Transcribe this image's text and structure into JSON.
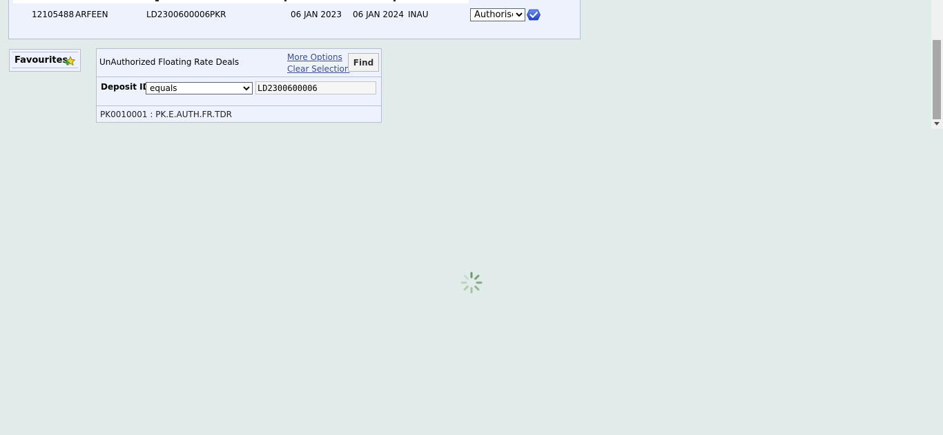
{
  "results": {
    "row": {
      "customer": "12105488",
      "name": "ARFEEN",
      "deal_id": "LD2300600006",
      "currency": "PKR",
      "value_date": "06 JAN 2023",
      "maturity_date": "06 JAN 2024",
      "status": "INAU",
      "action": {
        "selected": "Authorise",
        "options": [
          "Authorise"
        ]
      }
    },
    "go_icon": "check-go-icon"
  },
  "favourites": {
    "label": "Favourites",
    "icon": "add-star-icon"
  },
  "enquiry": {
    "title": "UnAuthorized Floating Rate Deals",
    "more_options": "More Options",
    "clear_selection": "Clear Selection",
    "find_label": "Find",
    "criteria": {
      "field_label": "Deposit ID",
      "operator": "equals",
      "operator_options": [
        "equals"
      ],
      "value": "LD2300600006"
    },
    "footer": "PK0010001 : PK.E.AUTH.FR.TDR"
  },
  "loading": {
    "icon": "loading-spinner-icon"
  },
  "colors": {
    "page_background": "#e1ebe9",
    "panel_background": "#eef2fd",
    "link": "#3b4f8f",
    "spinner": "#7fa87f"
  }
}
